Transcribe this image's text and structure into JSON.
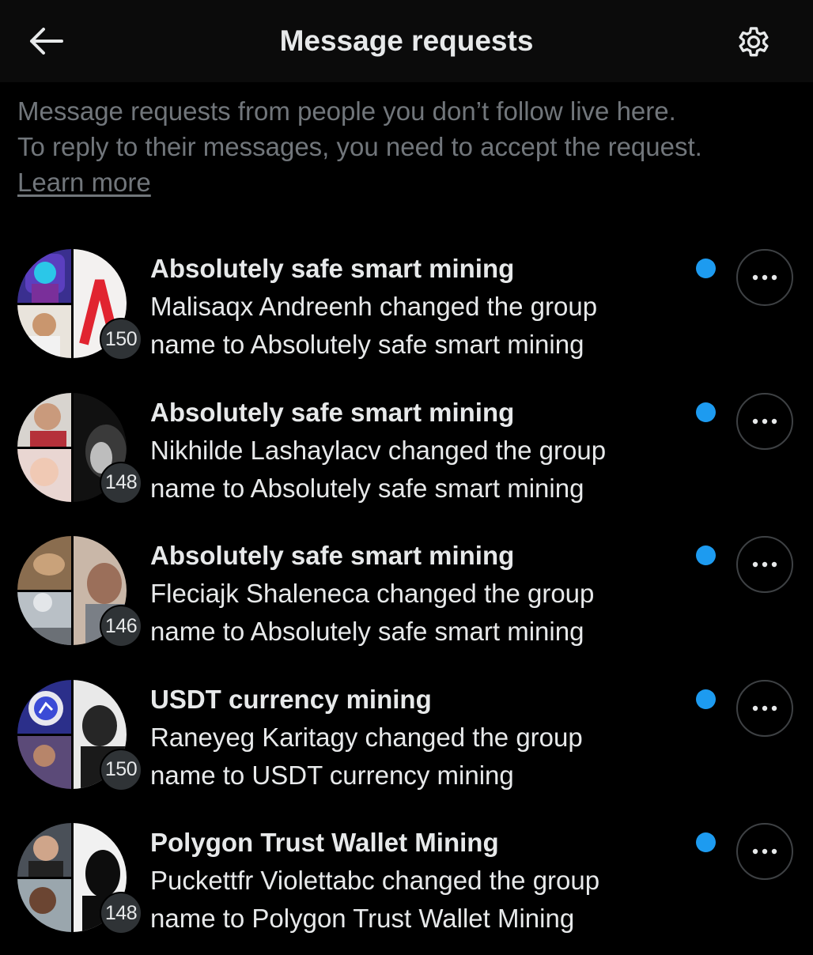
{
  "header": {
    "title": "Message requests",
    "back_icon": "arrow-left-icon",
    "settings_icon": "gear-icon"
  },
  "intro": {
    "line1": "Message requests from people you don’t follow live here.",
    "line2": "To reply to their messages, you need to accept the request.",
    "learn_more": "Learn more"
  },
  "colors": {
    "background": "#000000",
    "header_bg": "#0b0b0b",
    "primary_text": "#e7e9ea",
    "secondary_text": "#71767b",
    "unread_dot": "#1d9bf0",
    "badge_bg": "#2f3336"
  },
  "requests": [
    {
      "title": "Absolutely safe smart mining",
      "line1": "Malisaqx Andreenh changed the group",
      "line2": "name to Absolutely safe smart mining",
      "member_count": "150",
      "unread": true,
      "more_icon": "more-dots-icon"
    },
    {
      "title": "Absolutely safe smart mining",
      "line1": "Nikhilde Lashaylacv changed the group",
      "line2": "name to Absolutely safe smart mining",
      "member_count": "148",
      "unread": true,
      "more_icon": "more-dots-icon"
    },
    {
      "title": "Absolutely safe smart mining",
      "line1": "Fleciajk Shaleneca changed the group",
      "line2": "name to Absolutely safe smart mining",
      "member_count": "146",
      "unread": true,
      "more_icon": "more-dots-icon"
    },
    {
      "title": "USDT currency mining",
      "line1": "Raneyeg Karitagy changed the group",
      "line2": "name to USDT currency mining",
      "member_count": "150",
      "unread": true,
      "more_icon": "more-dots-icon"
    },
    {
      "title": "Polygon Trust Wallet Mining",
      "line1": "Puckettfr Violettabc changed the group",
      "line2": "name to Polygon Trust Wallet Mining",
      "member_count": "148",
      "unread": true,
      "more_icon": "more-dots-icon"
    }
  ]
}
